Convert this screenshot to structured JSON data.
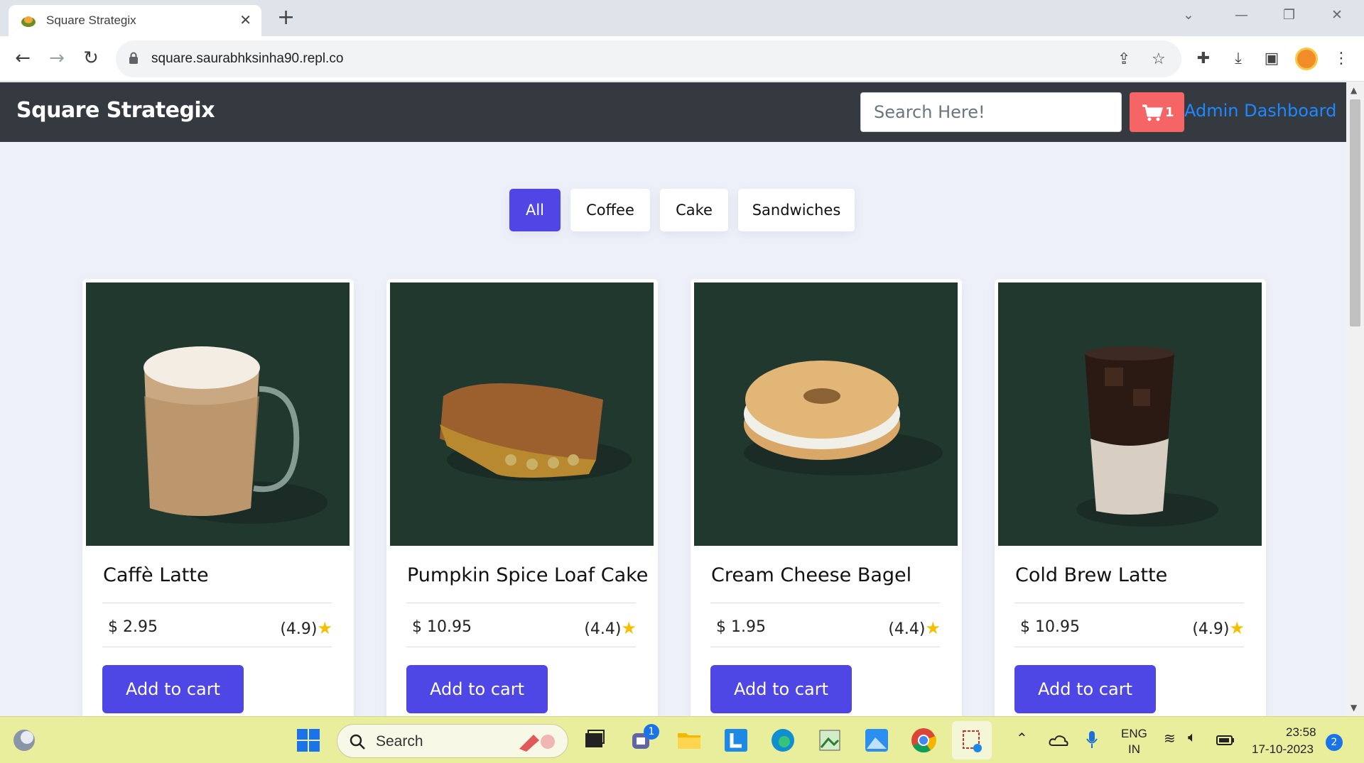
{
  "browser": {
    "tab_title": "Square Strategix",
    "url": "square.saurabhksinha90.repl.co"
  },
  "header": {
    "brand": "Square Strategix",
    "search_placeholder": "Search Here!",
    "cart_count": "1",
    "admin_link": "Admin Dashboard"
  },
  "filters": [
    {
      "label": "All",
      "active": true
    },
    {
      "label": "Coffee",
      "active": false
    },
    {
      "label": "Cake",
      "active": false
    },
    {
      "label": "Sandwiches",
      "active": false
    }
  ],
  "products": [
    {
      "name": "Caffè Latte",
      "price": "$ 2.95",
      "rating": "(4.9)",
      "button": "Add to cart"
    },
    {
      "name": "Pumpkin Spice Loaf Cake",
      "price": "$ 10.95",
      "rating": "(4.4)",
      "button": "Add to cart"
    },
    {
      "name": "Cream Cheese Bagel",
      "price": "$ 1.95",
      "rating": "(4.4)",
      "button": "Add to cart"
    },
    {
      "name": "Cold Brew Latte",
      "price": "$ 10.95",
      "rating": "(4.9)",
      "button": "Add to cart"
    }
  ],
  "taskbar": {
    "search_label": "Search",
    "chat_badge": "1",
    "lang_top": "ENG",
    "lang_bottom": "IN",
    "time": "23:58",
    "date": "17-10-2023",
    "notification_count": "2"
  },
  "colors": {
    "header_bg": "#343a40",
    "accent": "#5046e5",
    "cart_btn": "#f56565",
    "admin_link": "#1e88ff",
    "product_bg": "#21382f"
  }
}
